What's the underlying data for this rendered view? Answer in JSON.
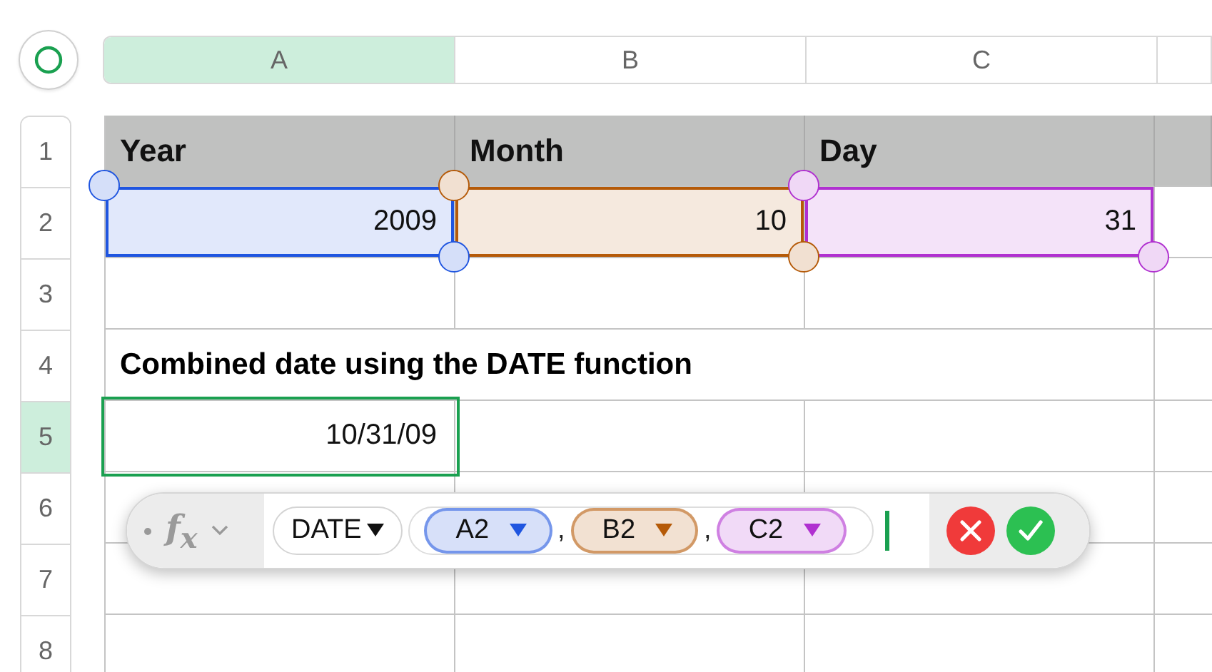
{
  "columns": [
    {
      "label": "A",
      "selected": true
    },
    {
      "label": "B",
      "selected": false
    },
    {
      "label": "C",
      "selected": false
    }
  ],
  "row_numbers": [
    {
      "label": "1",
      "selected": false
    },
    {
      "label": "2",
      "selected": false
    },
    {
      "label": "3",
      "selected": false
    },
    {
      "label": "4",
      "selected": false
    },
    {
      "label": "5",
      "selected": true
    },
    {
      "label": "6",
      "selected": false
    },
    {
      "label": "7",
      "selected": false
    },
    {
      "label": "8",
      "selected": false
    }
  ],
  "rows": [
    {
      "kind": "header",
      "cells": [
        {
          "text": "Year"
        },
        {
          "text": "Month"
        },
        {
          "text": "Day"
        }
      ]
    },
    {
      "kind": "data",
      "cells": [
        {
          "text": "2009",
          "selected": false,
          "color": "#1f55e0"
        },
        {
          "text": "10",
          "selected": false,
          "color": "#b55a08"
        },
        {
          "text": "31",
          "selected": false,
          "color": "#b030d0"
        }
      ]
    },
    {
      "kind": "empty"
    },
    {
      "kind": "title",
      "text": "Combined date using the DATE function"
    },
    {
      "kind": "data",
      "cells": [
        {
          "text": "10/31/09",
          "selected": true
        }
      ]
    },
    {
      "kind": "empty"
    },
    {
      "kind": "empty"
    },
    {
      "kind": "empty"
    }
  ],
  "formula_bar": {
    "fx": "f$_{x}$",
    "function": "DATE",
    "args": [
      {
        "text": "A2",
        "color": "#1f55e0"
      },
      {
        "text": "B2",
        "separator": ",",
        "color": "#b55a08"
      },
      {
        "text": "C2",
        "separator": ",",
        "color": "#b030d0"
      }
    ]
  }
}
